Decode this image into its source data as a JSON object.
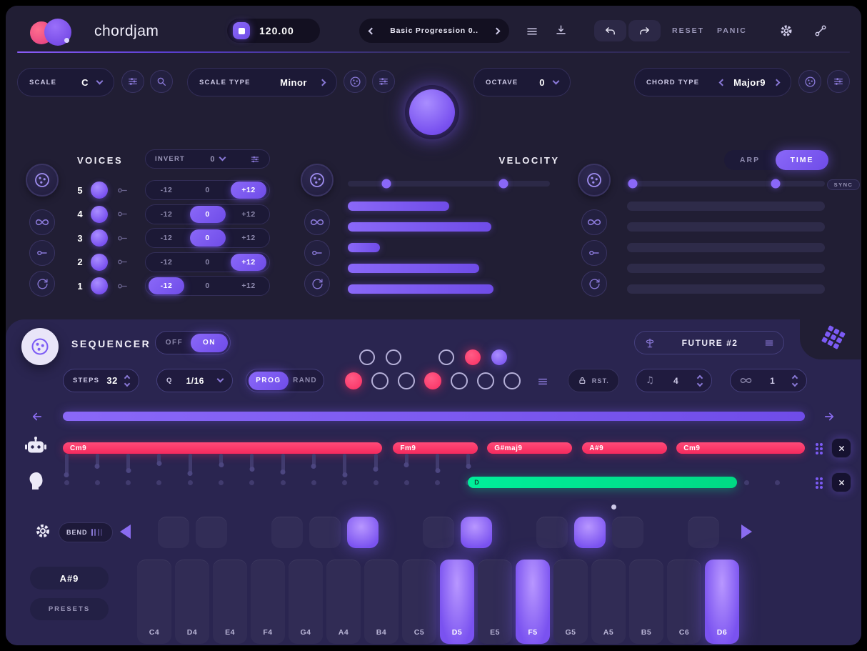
{
  "header": {
    "logo_text": "chordjam",
    "bpm": "120.00",
    "preset": "Basic Progression 0..",
    "reset_label": "RESET",
    "panic_label": "PANIC"
  },
  "controls": {
    "scale_label": "SCALE",
    "scale_value": "C",
    "scale_type_label": "SCALE TYPE",
    "scale_type_value": "Minor",
    "octave_label": "OCTAVE",
    "octave_value": "0",
    "chord_type_label": "CHORD TYPE",
    "chord_type_value": "Major9"
  },
  "voices": {
    "title": "VOICES",
    "invert_label": "INVERT",
    "invert_value": "0",
    "options": [
      "-12",
      "0",
      "+12"
    ],
    "rows": [
      {
        "num": "5",
        "on": true,
        "active": "+12"
      },
      {
        "num": "4",
        "on": true,
        "active": "0"
      },
      {
        "num": "3",
        "on": true,
        "active": "0"
      },
      {
        "num": "2",
        "on": true,
        "active": "+12"
      },
      {
        "num": "1",
        "on": true,
        "active": "-12"
      }
    ]
  },
  "velocity": {
    "title": "VELOCITY",
    "handles_pct": [
      19,
      77
    ],
    "bars_pct": [
      50,
      71,
      16,
      65,
      72
    ]
  },
  "time": {
    "arp_label": "ARP",
    "time_label": "TIME",
    "sync_label": "SYNC",
    "handles_pct": [
      3,
      75
    ],
    "bars_count": 5
  },
  "sequencer": {
    "title": "SEQUENCER",
    "off_label": "OFF",
    "on_label": "ON",
    "preset_name": "FUTURE #2",
    "steps_label": "STEPS",
    "steps_value": "32",
    "quantize_label": "Q",
    "quantize_value": "1/16",
    "prog_label": "PROG",
    "rand_label": "RAND",
    "rst_label": "RST.",
    "note_division_value": "4",
    "loop_count_value": "1",
    "top_steps": [
      "empty",
      "empty",
      "skip",
      "empty",
      "pink",
      "purple"
    ],
    "bottom_steps": [
      "pink",
      "empty",
      "empty",
      "pink",
      "empty",
      "empty",
      "empty"
    ]
  },
  "chord_track": {
    "chords": [
      {
        "label": "Cm9",
        "left_pct": 0,
        "width_pct": 43
      },
      {
        "label": "Fm9",
        "left_pct": 44.5,
        "width_pct": 11.4
      },
      {
        "label": "G#maj9",
        "left_pct": 57.2,
        "width_pct": 11.4
      },
      {
        "label": "A#9",
        "left_pct": 70,
        "width_pct": 11.4
      },
      {
        "label": "Cm9",
        "left_pct": 82.7,
        "width_pct": 17.3
      }
    ],
    "slider_heights": [
      30,
      18,
      24,
      14,
      28,
      16,
      22,
      26,
      18,
      30,
      22,
      16,
      24,
      18
    ]
  },
  "note_track": {
    "steps": 24,
    "bar": {
      "label": "D",
      "left_pct": 54.6,
      "width_pct": 36.3
    }
  },
  "keyboard": {
    "bend_label": "BEND",
    "chord_display": "A#9",
    "presets_label": "PRESETS",
    "white_keys": [
      {
        "label": "C4",
        "lit": false
      },
      {
        "label": "D4",
        "lit": false
      },
      {
        "label": "E4",
        "lit": false
      },
      {
        "label": "F4",
        "lit": false
      },
      {
        "label": "G4",
        "lit": false
      },
      {
        "label": "A4",
        "lit": false
      },
      {
        "label": "B4",
        "lit": false
      },
      {
        "label": "C5",
        "lit": false
      },
      {
        "label": "D5",
        "lit": true
      },
      {
        "label": "E5",
        "lit": false
      },
      {
        "label": "F5",
        "lit": true
      },
      {
        "label": "G5",
        "lit": false
      },
      {
        "label": "A5",
        "lit": false
      },
      {
        "label": "B5",
        "lit": false
      },
      {
        "label": "C6",
        "lit": false
      },
      {
        "label": "D6",
        "lit": true
      }
    ],
    "black_keys": [
      {
        "label": "C#4",
        "boundary": 1,
        "lit": false
      },
      {
        "label": "D#4",
        "boundary": 2,
        "lit": false
      },
      {
        "label": "F#4",
        "boundary": 4,
        "lit": false
      },
      {
        "label": "G#4",
        "boundary": 5,
        "lit": false
      },
      {
        "label": "A#4",
        "boundary": 6,
        "lit": true
      },
      {
        "label": "C#5",
        "boundary": 8,
        "lit": false
      },
      {
        "label": "D#5",
        "boundary": 9,
        "lit": true
      },
      {
        "label": "F#5",
        "boundary": 11,
        "lit": false
      },
      {
        "label": "G#5",
        "boundary": 12,
        "lit": true
      },
      {
        "label": "A#5",
        "boundary": 13,
        "lit": false
      },
      {
        "label": "C#6",
        "boundary": 15,
        "lit": false
      }
    ]
  },
  "colors": {
    "accent": "#7c5bf5",
    "pink": "#fa2e62",
    "green": "#00e591"
  }
}
